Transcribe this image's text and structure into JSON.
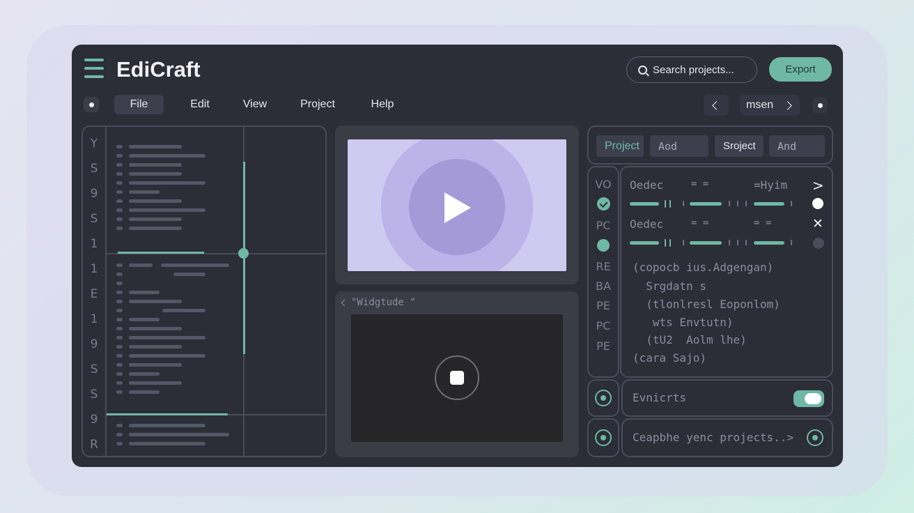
{
  "app": {
    "name": "EdiCraft"
  },
  "header": {
    "search_placeholder": "Search projects...",
    "export_label": "Export"
  },
  "menu": {
    "items": [
      "File",
      "Edit",
      "View",
      "Project",
      "Help"
    ]
  },
  "nav": {
    "label": "msen"
  },
  "left_panel": {
    "letters": [
      "Y",
      "S",
      "9",
      "S",
      "1",
      "1",
      "E",
      "1",
      "9",
      "S",
      "S",
      "9",
      "R"
    ]
  },
  "player": {
    "title": "\"Widgtude \""
  },
  "right_tabs": [
    "Project",
    "Aod",
    "Sroject",
    "And"
  ],
  "right_side": {
    "labels": [
      "VO",
      "PC",
      "RE",
      "BA",
      "PE",
      "PC",
      "PE"
    ]
  },
  "main": {
    "row1": {
      "label": "Oedec",
      "mid": "= =",
      "right": "=Hyim",
      "icon": "chevron-right-icon"
    },
    "row2": {
      "label": "Oedec",
      "mid": "= =",
      "right": "= =",
      "icon": "close-icon"
    },
    "code": [
      "(copocb ius.Adgengan)",
      "  Srgdatn s",
      "  (tlonlresl Eoponlom)",
      "   wts Envtutn)",
      "  (tU2  Aolm lhe)",
      "(cara Sajo)"
    ]
  },
  "toggle_row": {
    "label": "Evnicrts",
    "enabled": true
  },
  "bottom_row": {
    "label": "Ceapbhe yenc projects..>"
  },
  "colors": {
    "accent": "#6fb8a6",
    "surface": "#2b2d37",
    "video_bg": "#cfcaf0"
  }
}
